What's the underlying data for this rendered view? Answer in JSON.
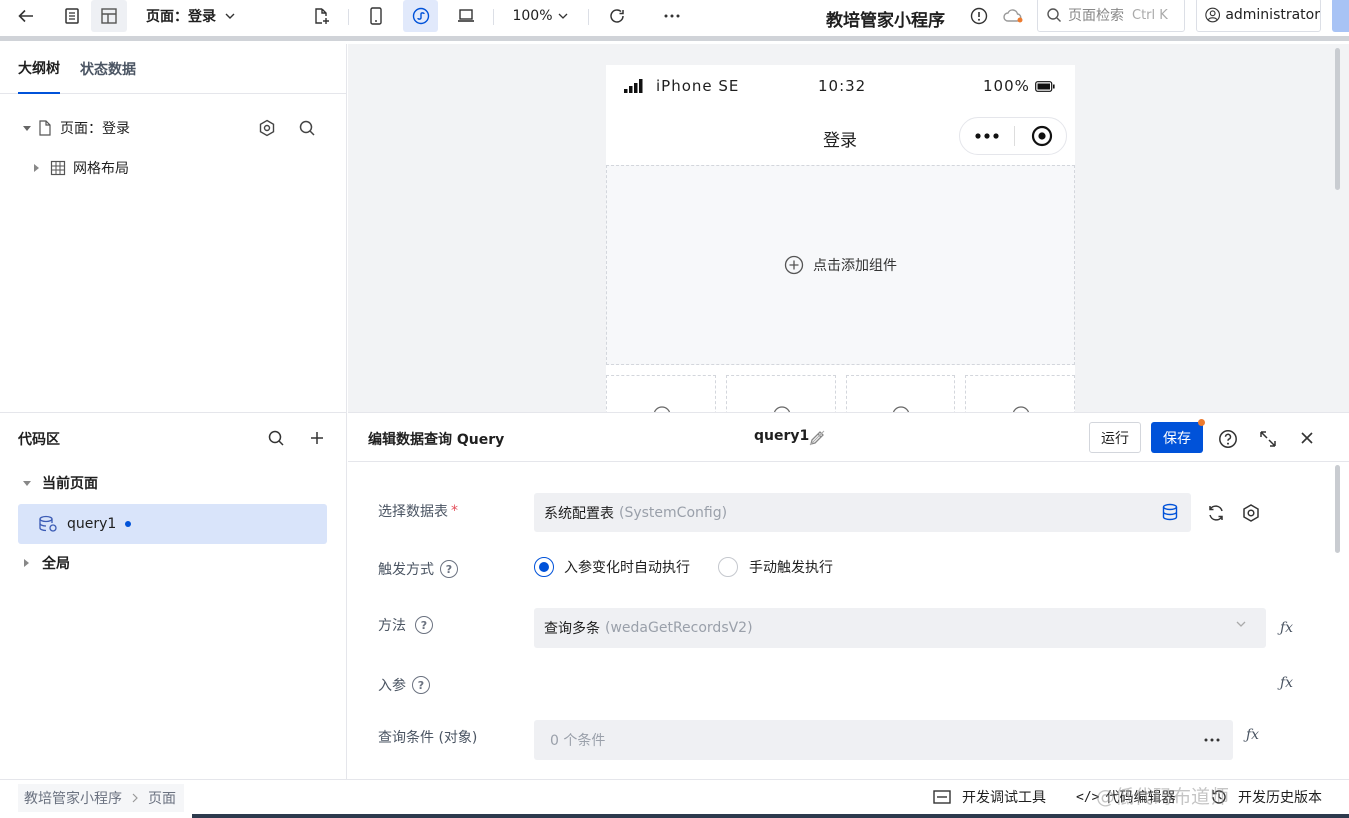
{
  "topbar": {
    "page_selector": "页面：登录",
    "zoom": "100%",
    "app_title": "教培管家小程序",
    "search_placeholder": "页面检索",
    "search_shortcut": "Ctrl K",
    "user": "administrator"
  },
  "left_panel": {
    "tabs": [
      "大纲树",
      "状态数据"
    ],
    "tree": {
      "page_label": "页面：登录",
      "child_label": "网格布局"
    }
  },
  "canvas": {
    "phone": {
      "device": "iPhone SE",
      "time": "10:32",
      "battery": "100%",
      "page_title": "登录",
      "add_component": "点击添加组件"
    }
  },
  "code_area": {
    "title": "代码区",
    "current_page": "当前页面",
    "query_item": "query1",
    "global": "全局"
  },
  "editor": {
    "title": "编辑数据查询 Query",
    "query_name": "query1",
    "run_label": "运行",
    "save_label": "保存",
    "fields": {
      "datasource_label": "选择数据表",
      "datasource_value": "系统配置表",
      "datasource_hint": "(SystemConfig)",
      "trigger_label": "触发方式",
      "trigger_options": [
        "入参变化时自动执行",
        "手动触发执行"
      ],
      "trigger_selected": 0,
      "method_label": "方法",
      "method_value": "查询多条",
      "method_hint": "(wedaGetRecordsV2)",
      "params_label": "入参",
      "condition_label": "查询条件 (对象)",
      "condition_value": "0 个条件"
    }
  },
  "footer": {
    "breadcrumb": [
      "教培管家小程序",
      "页面"
    ],
    "tools": [
      "开发调试工具",
      "代码编辑器",
      "开发历史版本"
    ],
    "watermark": "@低代码布道师"
  },
  "colors": {
    "accent": "#0052d9",
    "danger": "#e34d59",
    "badge": "#ed7b2f"
  }
}
